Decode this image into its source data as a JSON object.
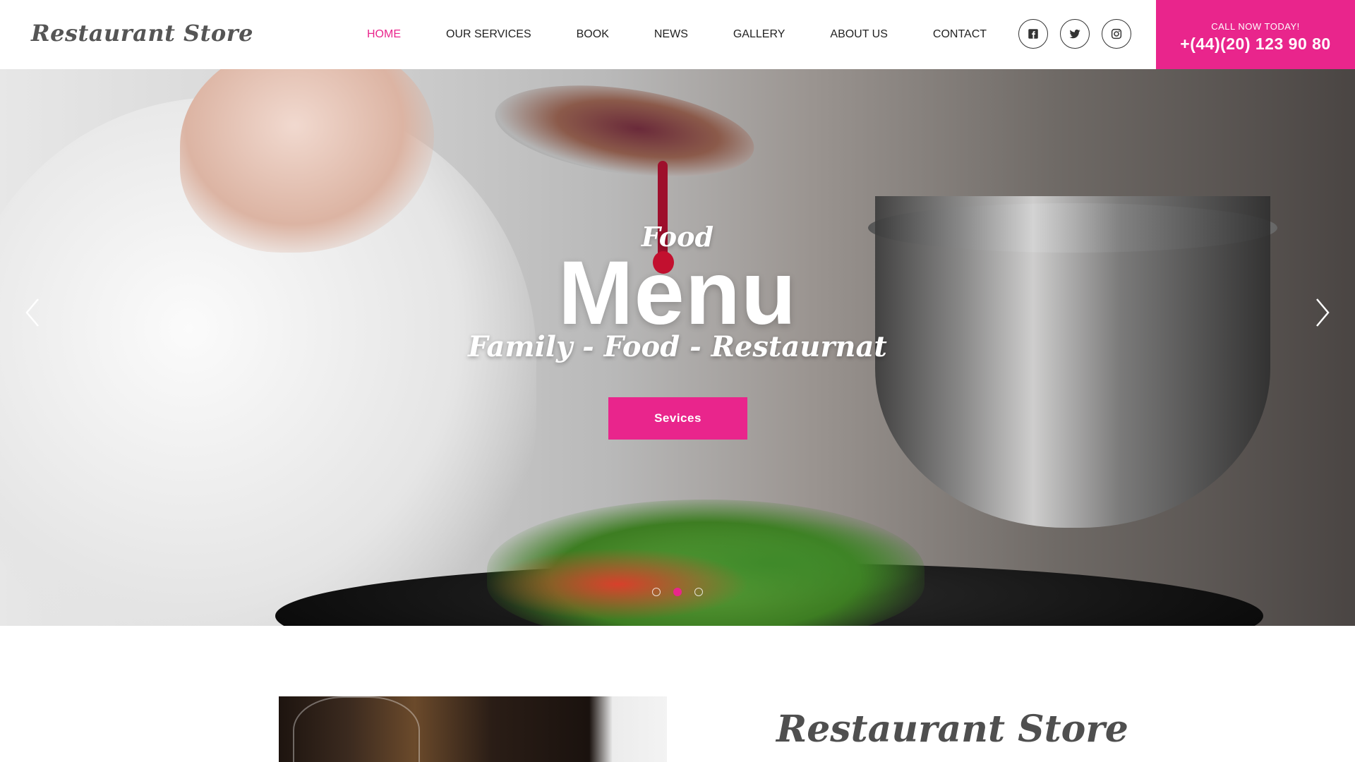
{
  "brand": {
    "logo_text": "Restaurant Store"
  },
  "nav": {
    "items": [
      {
        "label": "HOME",
        "active": true
      },
      {
        "label": "OUR SERVICES",
        "active": false
      },
      {
        "label": "BOOK",
        "active": false
      },
      {
        "label": "NEWS",
        "active": false
      },
      {
        "label": "GALLERY",
        "active": false
      },
      {
        "label": "ABOUT US",
        "active": false
      },
      {
        "label": "CONTACT",
        "active": false
      }
    ]
  },
  "social": {
    "icons": [
      "facebook-icon",
      "twitter-icon",
      "instagram-icon"
    ]
  },
  "call": {
    "label": "CALL NOW TODAY!",
    "phone": "+(44)(20) 123 90 80"
  },
  "hero": {
    "pre_title": "Food",
    "title": "Menu",
    "subtitle": "Family - Food - Restaurnat",
    "button_label": "Sevices",
    "slides_total": 3,
    "active_slide": 2
  },
  "about": {
    "title": "Restaurant Store"
  },
  "colors": {
    "accent": "#e9258c",
    "text": "#222222",
    "logo": "#555555"
  }
}
